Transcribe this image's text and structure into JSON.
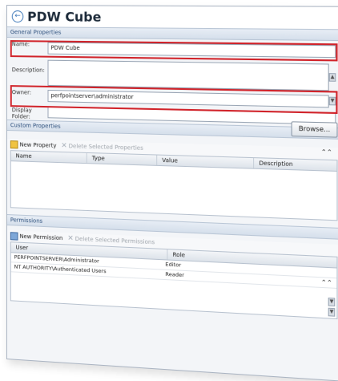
{
  "page": {
    "title": "PDW Cube"
  },
  "general": {
    "header": "General Properties",
    "name_label": "Name:",
    "name_value": "PDW Cube",
    "description_label": "Description:",
    "description_value": "",
    "owner_label": "Owner:",
    "owner_value": "perfpointserver\\administrator",
    "display_folder_label": "Display Folder:",
    "display_folder_value": "",
    "browse_label": "Browse..."
  },
  "custom": {
    "header": "Custom Properties",
    "new_label": "New Property",
    "delete_label": "Delete Selected Properties",
    "columns": [
      "Name",
      "Type",
      "Value",
      "Description"
    ]
  },
  "permissions": {
    "header": "Permissions",
    "new_label": "New Permission",
    "delete_label": "Delete Selected Permissions",
    "user_column": "User",
    "role_column": "Role",
    "rows": [
      {
        "user": "PERFPOINTSERVER\\Administrator",
        "role": "Editor"
      },
      {
        "user": "NT AUTHORITY\\Authenticated Users",
        "role": "Reader"
      }
    ]
  },
  "colors": {
    "highlight": "#d1232a",
    "accent": "#2c4f7c"
  },
  "icons": {
    "back": "back-arrow-icon",
    "new": "new-item-icon",
    "delete": "delete-x-icon",
    "collapse": "double-chevron-up-icon",
    "dropdown": "chevron-down-icon"
  }
}
